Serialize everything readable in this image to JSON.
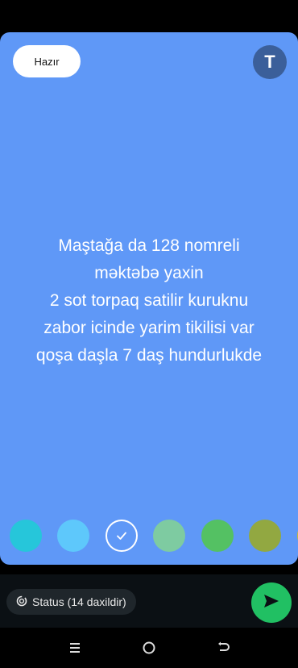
{
  "header": {
    "done_label": "Hazır",
    "text_tool_label": "T"
  },
  "status": {
    "lines": [
      "Maştağa da 128 nomreli",
      "məktəbə yaxin",
      "2 sot torpaq satilir kuruknu",
      "zabor icinde yarim tikilisi var",
      "qoşa daşla 7 daş hundurlukde"
    ],
    "background_color": "#5f98f7"
  },
  "swatches": [
    {
      "color": "#26c6da",
      "selected": false
    },
    {
      "color": "#5ec8fb",
      "selected": false
    },
    {
      "color": "#5f98f7",
      "selected": true
    },
    {
      "color": "#7ecba1",
      "selected": false
    },
    {
      "color": "#54c163",
      "selected": false
    },
    {
      "color": "#92a841",
      "selected": false
    },
    {
      "color": "#c8b92c",
      "selected": false
    }
  ],
  "footer": {
    "audience_label": "Status (14 daxildir)",
    "audience_icon": "status-ring-icon",
    "send_icon": "send-icon",
    "accent_color": "#21c063"
  },
  "system_nav": {
    "buttons": [
      "menu-icon",
      "home-icon",
      "back-icon"
    ]
  }
}
